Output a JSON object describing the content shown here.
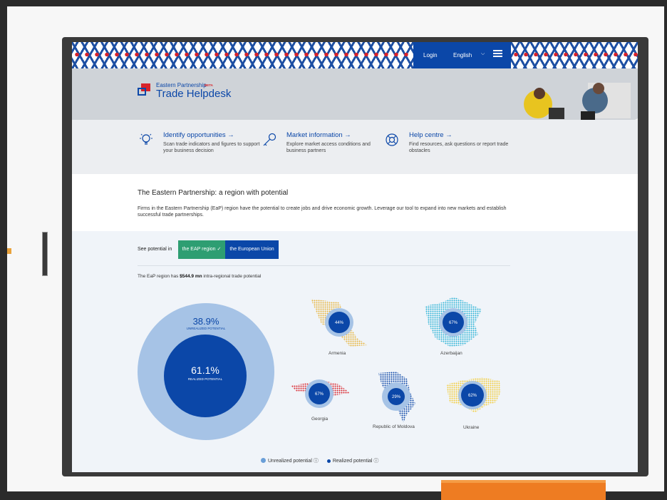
{
  "header": {
    "login_label": "Login",
    "language_label": "English",
    "colors": {
      "brand_blue": "#0b47a8",
      "brand_red": "#d8232a"
    }
  },
  "brand": {
    "small": "Eastern Partnership",
    "beta": "BETA",
    "big": "Trade Helpdesk"
  },
  "features": [
    {
      "title": "Identify opportunities →",
      "desc": "Scan trade indicators and figures to support your business decision",
      "icon": "lightbulb-icon"
    },
    {
      "title": "Market information →",
      "desc": "Explore market access conditions and business partners",
      "icon": "key-icon"
    },
    {
      "title": "Help centre →",
      "desc": "Find resources, ask questions or report trade obstacles",
      "icon": "lifebuoy-icon"
    }
  ],
  "intro": {
    "title": "The Eastern Partnership: a region with potential",
    "text": "Firms in the Eastern Partnership (EaP) region have the potential to create jobs and drive economic growth. Leverage our tool to expand into new markets and establish successful trade partnerships."
  },
  "potential": {
    "see_label": "See potential in",
    "tab_eap": "the EAP region ✓",
    "tab_eu": "the European Union",
    "trade_prefix": "The EaP region has ",
    "trade_value": "$544.9 mn",
    "trade_suffix": " intra-regional trade potential",
    "unrealized_pct": "38.9%",
    "unrealized_label": "UNREALIZED POTENTIAL",
    "realized_pct": "61.1%",
    "realized_label": "REALIZED POTENTIAL",
    "countries": [
      {
        "name": "Armenia",
        "pct": "44%",
        "color": "#e8b43a"
      },
      {
        "name": "Azerbaijan",
        "pct": "67%",
        "color": "#2bb3d6"
      },
      {
        "name": "Georgia",
        "pct": "67%",
        "color": "#d8232a"
      },
      {
        "name": "Republic of Moldova",
        "pct": "29%",
        "color": "#0b47a8"
      },
      {
        "name": "Ukraine",
        "pct": "62%",
        "color": "#f2cd3a"
      }
    ],
    "legend": {
      "unrealized": "Unrealized potential ⓘ",
      "realized": "Realized potential ⓘ",
      "unrealized_color": "#6a9fd8",
      "realized_color": "#0b47a8"
    }
  }
}
